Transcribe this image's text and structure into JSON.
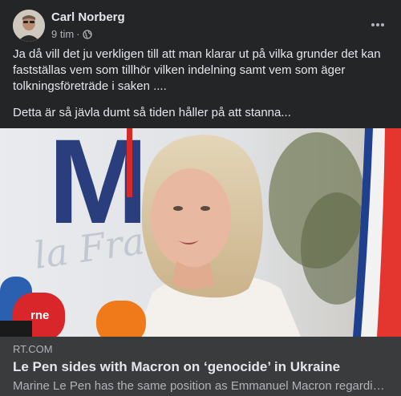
{
  "post": {
    "author": "Carl Norberg",
    "time": "9 tim",
    "separator": "·",
    "privacy_icon": "globe-icon",
    "more_icon": "more-horizontal-icon",
    "paragraphs": [
      "Ja då vill det ju verkligen till att man klarar ut på vilka grunder det kan fastställas vem som tillhör vilken indelning samt vem som äger tolkningsföreträde i saken ....",
      "Detta är så jävla dumt så tiden håller på att stanna..."
    ]
  },
  "link": {
    "domain": "RT.COM",
    "headline": "Le Pen sides with Macron on ‘genocide’ in Ukraine",
    "description": "Marine Le Pen has the same position as Emmanuel Macron regarding the use of the word genocide in Ukraine"
  },
  "image": {
    "backdrop_letter": "M",
    "backdrop_script": "la France",
    "mic_label": "rne",
    "colors": {
      "blue": "#2a3d7c",
      "red": "#d62a2a",
      "backdrop": "#e7e9ec"
    }
  }
}
